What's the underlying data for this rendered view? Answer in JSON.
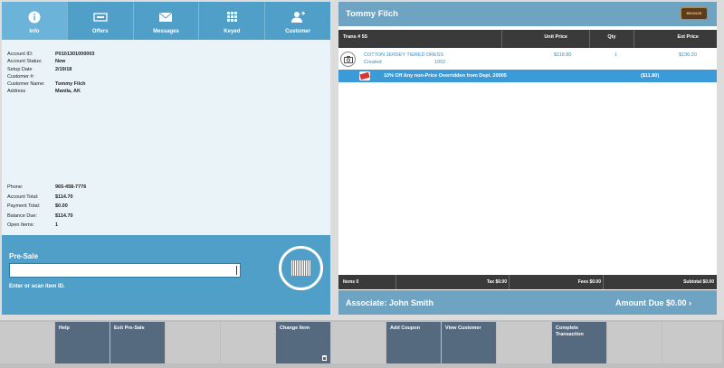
{
  "tabs": [
    {
      "label": "Info",
      "icon": "info-icon",
      "active": true
    },
    {
      "label": "Offers",
      "icon": "offers-icon",
      "active": false
    },
    {
      "label": "Messages",
      "icon": "envelope-icon",
      "active": false
    },
    {
      "label": "Keyed",
      "icon": "keypad-icon",
      "active": false
    },
    {
      "label": "Customer",
      "icon": "add-user-icon",
      "active": false
    }
  ],
  "account": {
    "rows": [
      {
        "label": "Account ID:",
        "value": "P0101301000003"
      },
      {
        "label": "Account Status:",
        "value": "New"
      },
      {
        "label": "Setup Date",
        "value": "2/19/18"
      },
      {
        "label": "Customer #:",
        "value": ""
      },
      {
        "label": "Customer Name:",
        "value": "Tommy Filch"
      },
      {
        "label": "Address",
        "value": "Manila, AK"
      }
    ],
    "rows2": [
      {
        "label": "Phone:",
        "value": "965-458-7776"
      },
      {
        "label": "Account Total:",
        "value": "$114.70"
      },
      {
        "label": "Payment Total:",
        "value": "$0.00"
      },
      {
        "label": "Balance Due:",
        "value": "$114.70"
      },
      {
        "label": "Open Items:",
        "value": "1"
      }
    ]
  },
  "presale": {
    "title": "Pre-Sale",
    "input_value": "",
    "hint": "Enter or scan item ID."
  },
  "transaction": {
    "customer_name": "Tommy Filch",
    "logo_text": "BRONZE",
    "headers": {
      "trans": "Trans # 55",
      "unit_price": "Unit Price",
      "qty": "Qty",
      "ext_price": "Ext Price"
    },
    "item": {
      "name": "COTTON JERSEY TIERED DRESS",
      "status": "Created",
      "sku": "1002",
      "unit_price": "$118.80",
      "qty": "1",
      "ext_price": "$136.20"
    },
    "discount": {
      "text": "10% Off Any non-Price Overridden from Dept. 20005",
      "amount": "($11.80)"
    },
    "totals": {
      "items": "Items 0",
      "tax": "Tax $0.00",
      "fees": "Fees $0.00",
      "subtotal": "Subtotal $0.00"
    },
    "associate": "Associate: John Smith",
    "amount_due": "Amount Due  $0.00  ›"
  },
  "toolbar": [
    {
      "label": "",
      "enabled": false
    },
    {
      "label": "Help",
      "enabled": true
    },
    {
      "label": "Exit Pre-Sale",
      "enabled": true
    },
    {
      "label": "",
      "enabled": false
    },
    {
      "label": "",
      "enabled": false
    },
    {
      "label": "Change Item",
      "enabled": true
    },
    {
      "label": "",
      "enabled": false
    },
    {
      "label": "Add Coupon",
      "enabled": true
    },
    {
      "label": "View Customer",
      "enabled": true
    },
    {
      "label": "",
      "enabled": false
    },
    {
      "label": "Complete Transaction",
      "enabled": true
    },
    {
      "label": "",
      "enabled": false
    },
    {
      "label": "",
      "enabled": false
    }
  ],
  "colors": {
    "primary": "#4f9fc9",
    "header": "#6fa3c2",
    "dark": "#3a3a3a",
    "button": "#566a7f",
    "highlight": "#3a9bd8"
  }
}
